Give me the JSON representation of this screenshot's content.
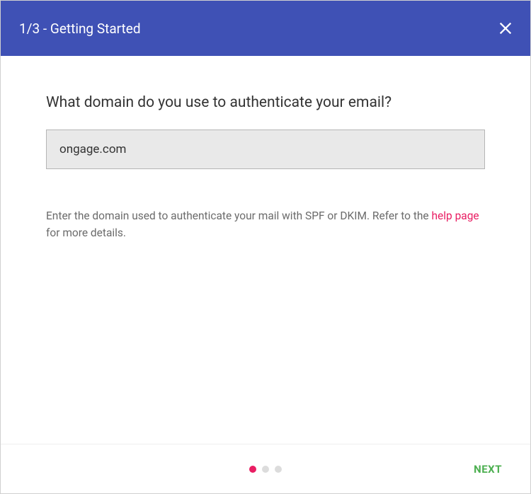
{
  "header": {
    "title": "1/3 - Getting Started"
  },
  "main": {
    "question": "What domain do you use to authenticate your email?",
    "domain_value": "ongage.com",
    "hint_prefix": "Enter the domain used to authenticate your mail with SPF or DKIM. Refer to the ",
    "hint_link": "help page",
    "hint_suffix": " for more details."
  },
  "footer": {
    "next_label": "NEXT",
    "step_active": 1,
    "step_total": 3
  }
}
